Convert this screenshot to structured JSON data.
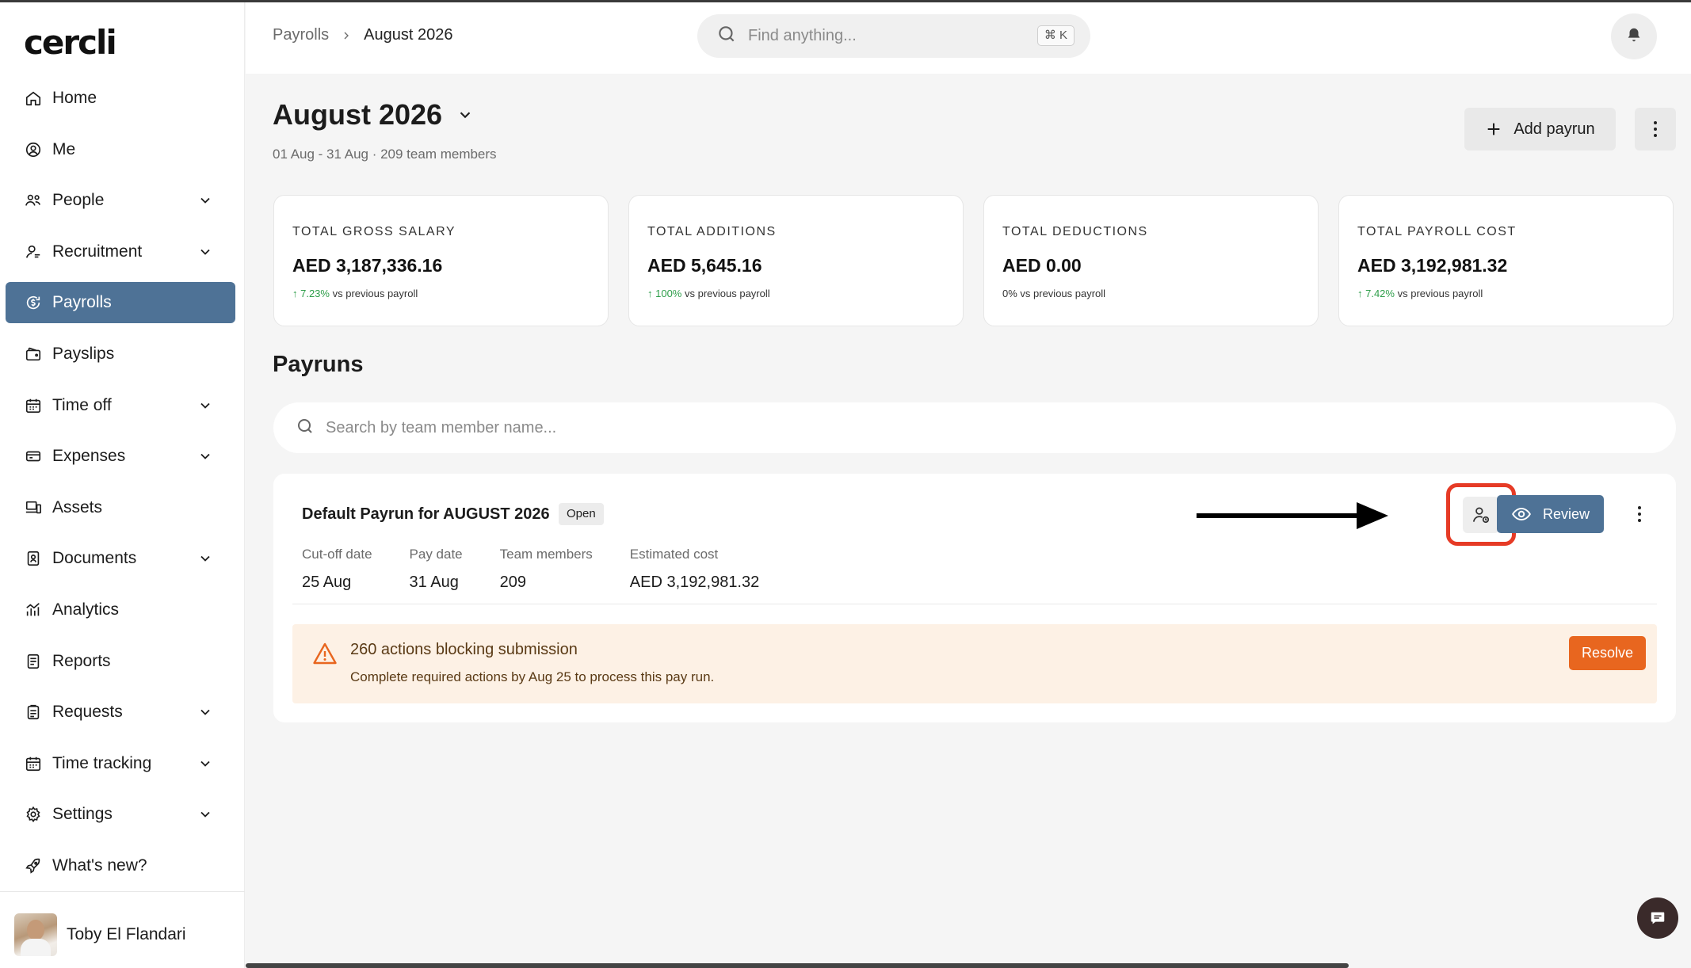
{
  "app": {
    "logo": "cercli"
  },
  "sidebar": {
    "items": [
      {
        "label": "Home",
        "icon": "home-icon",
        "expandable": false,
        "active": false
      },
      {
        "label": "Me",
        "icon": "user-circle-icon",
        "expandable": false,
        "active": false
      },
      {
        "label": "People",
        "icon": "people-icon",
        "expandable": true,
        "active": false
      },
      {
        "label": "Recruitment",
        "icon": "user-search-icon",
        "expandable": true,
        "active": false
      },
      {
        "label": "Payrolls",
        "icon": "payroll-icon",
        "expandable": false,
        "active": true
      },
      {
        "label": "Payslips",
        "icon": "wallet-icon",
        "expandable": false,
        "active": false
      },
      {
        "label": "Time off",
        "icon": "calendar-icon",
        "expandable": true,
        "active": false
      },
      {
        "label": "Expenses",
        "icon": "receipt-icon",
        "expandable": true,
        "active": false
      },
      {
        "label": "Assets",
        "icon": "laptop-icon",
        "expandable": false,
        "active": false
      },
      {
        "label": "Documents",
        "icon": "document-icon",
        "expandable": true,
        "active": false
      },
      {
        "label": "Analytics",
        "icon": "analytics-icon",
        "expandable": false,
        "active": false
      },
      {
        "label": "Reports",
        "icon": "report-icon",
        "expandable": false,
        "active": false
      },
      {
        "label": "Requests",
        "icon": "clipboard-icon",
        "expandable": true,
        "active": false
      },
      {
        "label": "Time tracking",
        "icon": "calendar-clock-icon",
        "expandable": true,
        "active": false
      },
      {
        "label": "Settings",
        "icon": "gear-icon",
        "expandable": true,
        "active": false
      },
      {
        "label": "What's new?",
        "icon": "rocket-icon",
        "expandable": false,
        "active": false
      }
    ],
    "user": {
      "name": "Toby El Flandari"
    }
  },
  "header": {
    "breadcrumb": {
      "root": "Payrolls",
      "current": "August 2026"
    },
    "search": {
      "placeholder": "Find anything...",
      "shortcut": "⌘ K"
    }
  },
  "page": {
    "title": "August 2026",
    "subtitle": "01 Aug - 31 Aug · 209 team members",
    "add_button": "Add payrun"
  },
  "stats": [
    {
      "label": "TOTAL GROSS SALARY",
      "value": "AED 3,187,336.16",
      "delta": "↑ 7.23%",
      "delta_suffix": " vs previous payroll",
      "trend": "up"
    },
    {
      "label": "TOTAL ADDITIONS",
      "value": "AED 5,645.16",
      "delta": "↑ 100%",
      "delta_suffix": " vs previous payroll",
      "trend": "up"
    },
    {
      "label": "TOTAL DEDUCTIONS",
      "value": "AED 0.00",
      "delta": "0%",
      "delta_suffix": " vs previous payroll",
      "trend": "flat"
    },
    {
      "label": "TOTAL PAYROLL COST",
      "value": "AED 3,192,981.32",
      "delta": "↑ 7.42%",
      "delta_suffix": " vs previous payroll",
      "trend": "up"
    }
  ],
  "payruns": {
    "section_title": "Payruns",
    "search_placeholder": "Search by team member name...",
    "card": {
      "title": "Default Payrun for AUGUST 2026",
      "status": "Open",
      "meta": [
        {
          "label": "Cut-off date",
          "value": "25 Aug"
        },
        {
          "label": "Pay date",
          "value": "31 Aug"
        },
        {
          "label": "Team members",
          "value": "209"
        },
        {
          "label": "Estimated cost",
          "value": "AED 3,192,981.32"
        }
      ],
      "review_button": "Review",
      "alert": {
        "title": "260 actions blocking submission",
        "subtitle": "Complete required actions by Aug 25 to process this pay run.",
        "button": "Resolve"
      }
    }
  },
  "colors": {
    "accent": "#4e7296",
    "warning": "#e8661f",
    "highlight": "#e63b26",
    "positive": "#2e9e4a"
  }
}
